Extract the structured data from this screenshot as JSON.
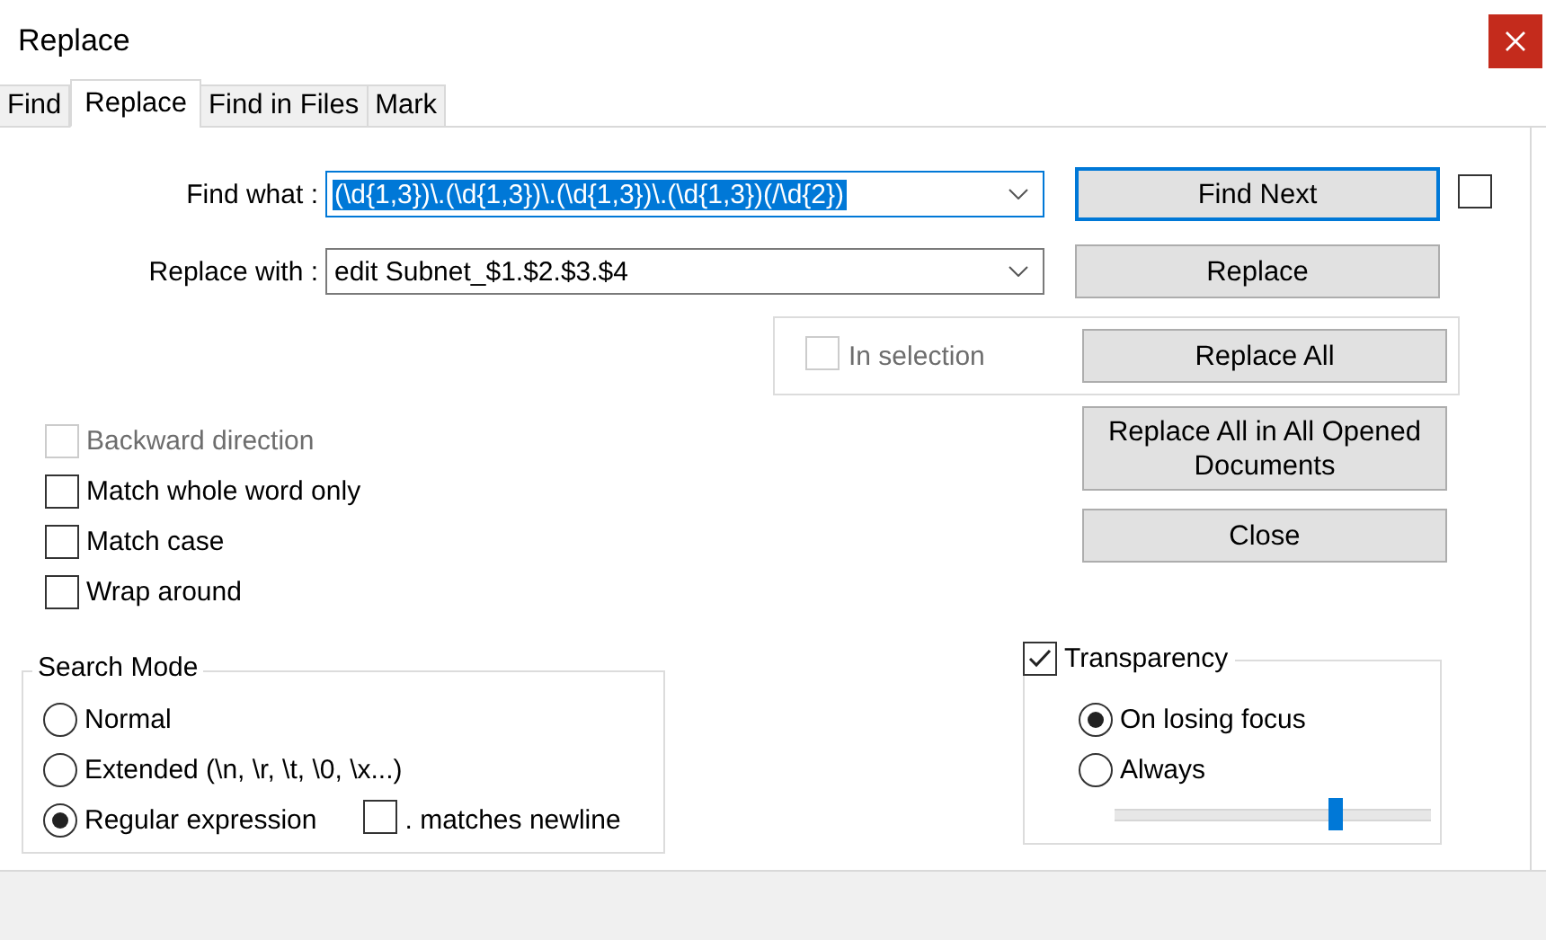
{
  "window": {
    "title": "Replace"
  },
  "tabs": [
    {
      "label": "Find",
      "selected": false
    },
    {
      "label": "Replace",
      "selected": true
    },
    {
      "label": "Find in Files",
      "selected": false
    },
    {
      "label": "Mark",
      "selected": false
    }
  ],
  "find_what": {
    "label": "Find what :",
    "value": "(\\d{1,3})\\.(\\d{1,3})\\.(\\d{1,3})\\.(\\d{1,3})(/\\d{2})",
    "text_selected": true
  },
  "replace_with": {
    "label": "Replace with :",
    "value": "edit Subnet_$1.$2.$3.$4",
    "text_selected": false
  },
  "find_next_button": {
    "label": "Find Next",
    "focused": true
  },
  "find_next_checkbox": {
    "checked": false
  },
  "replace_button": {
    "label": "Replace",
    "focused": false
  },
  "in_selection": {
    "label": "In selection",
    "checked": false,
    "disabled": true
  },
  "replace_all_button": {
    "label": "Replace All",
    "focused": false
  },
  "replace_all_opened_button": {
    "label": "Replace All in All Opened Documents",
    "focused": false
  },
  "close_button": {
    "label": "Close",
    "focused": false
  },
  "options": [
    {
      "label": "Backward direction",
      "checked": false,
      "disabled": true
    },
    {
      "label": "Match whole word only",
      "checked": false,
      "disabled": false
    },
    {
      "label": "Match case",
      "checked": false,
      "disabled": false
    },
    {
      "label": "Wrap around",
      "checked": false,
      "disabled": false
    }
  ],
  "search_mode": {
    "title": "Search Mode",
    "options": [
      {
        "label": "Normal",
        "selected": false
      },
      {
        "label": "Extended (\\n, \\r, \\t, \\0, \\x...)",
        "selected": false
      },
      {
        "label": "Regular expression",
        "selected": true
      }
    ],
    "dot_matches_newline": {
      "label": ". matches newline",
      "checked": false,
      "disabled": false
    }
  },
  "transparency": {
    "label": "Transparency",
    "checked": true,
    "options": [
      {
        "label": "On losing focus",
        "selected": true
      },
      {
        "label": "Always",
        "selected": false
      }
    ],
    "level": 0.7
  }
}
